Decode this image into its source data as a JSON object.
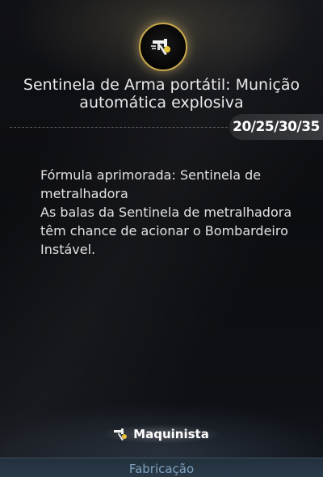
{
  "skill": {
    "title_line1": "Sentinela de Arma portátil: Munição",
    "title_line2": "automática explosiva",
    "levels": "20/25/30/35",
    "icon": "machinist-gun-icon"
  },
  "description": {
    "line1": "Fórmula aprimorada: Sentinela de metralhadora",
    "line2": "As balas da Sentinela de metralhadora têm chance de acionar o Bombardeiro Instável."
  },
  "class": {
    "name": "Maquinista",
    "icon": "machinist-class-icon"
  },
  "footer": {
    "tab_label": "Fabricação"
  },
  "colors": {
    "accent_gold": "#c9a94a",
    "footer_text": "#7fa1bf"
  }
}
